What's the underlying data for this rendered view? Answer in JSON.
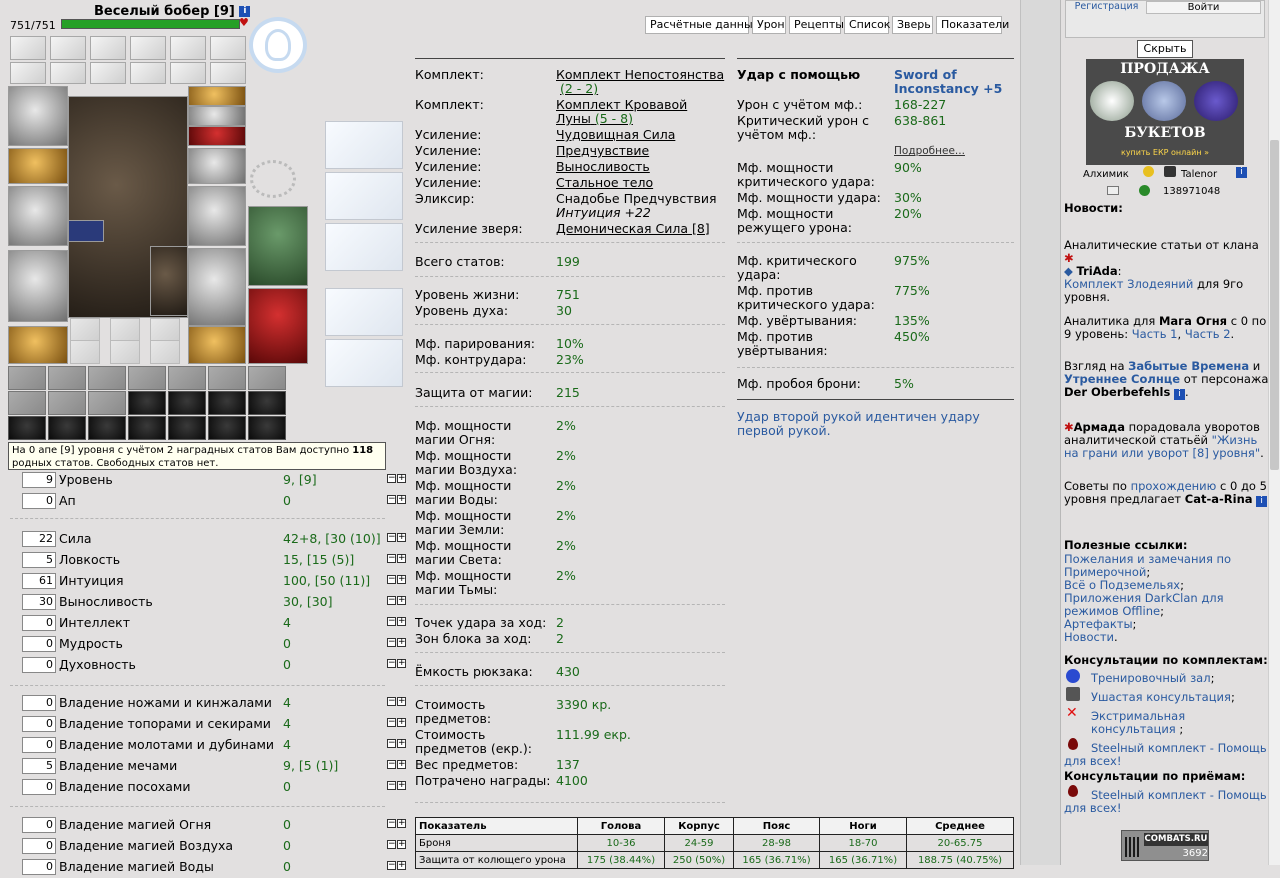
{
  "character": {
    "name": "Веселый бобер",
    "level": "[9]",
    "hp": "751/751"
  },
  "tabs": [
    "Расчётные данные",
    "Урон",
    "Рецепты",
    "Список",
    "Зверь",
    "Показатели"
  ],
  "level_tooltip": {
    "pre": "На 0 апе [9] уровня с учётом 2 наградных статов Вам доступно ",
    "num": "118",
    "post": " родных статов. Свободных статов нет."
  },
  "stats": [
    {
      "input": "9",
      "label": "Уровень",
      "value": "9, [9]"
    },
    {
      "input": "0",
      "label": "Ап",
      "value": "0"
    },
    {
      "input": "22",
      "label": "Сила",
      "value": "42+8, [30 (10)]"
    },
    {
      "input": "5",
      "label": "Ловкость",
      "value": "15, [15 (5)]"
    },
    {
      "input": "61",
      "label": "Интуиция",
      "value": "100, [50 (11)]"
    },
    {
      "input": "30",
      "label": "Выносливость",
      "value": "30, [30]"
    },
    {
      "input": "0",
      "label": "Интеллект",
      "value": "4"
    },
    {
      "input": "0",
      "label": "Мудрость",
      "value": "0"
    },
    {
      "input": "0",
      "label": "Духовность",
      "value": "0"
    },
    {
      "input": "0",
      "label": "Владение ножами и кинжалами",
      "value": "4"
    },
    {
      "input": "0",
      "label": "Владение топорами и секирами",
      "value": "4"
    },
    {
      "input": "0",
      "label": "Владение молотами и дубинами",
      "value": "4"
    },
    {
      "input": "5",
      "label": "Владение мечами",
      "value": "9, [5 (1)]"
    },
    {
      "input": "0",
      "label": "Владение посохами",
      "value": "0"
    },
    {
      "input": "0",
      "label": "Владение магией Огня",
      "value": "0"
    },
    {
      "input": "0",
      "label": "Владение магией Воздуха",
      "value": "0"
    },
    {
      "input": "0",
      "label": "Владение магией Воды",
      "value": "0"
    }
  ],
  "center": {
    "sets": [
      {
        "label": "Комплект:",
        "value": "Комплект Непостоянства",
        "extra": "(2 - 2)"
      },
      {
        "label": "Комплект:",
        "value": "Комплект Кровавой Луны",
        "extra": "(5 - 8)"
      }
    ],
    "boosts": [
      {
        "label": "Усиление:",
        "value": "Чудовищная Сила"
      },
      {
        "label": "Усиление:",
        "value": "Предчувствие"
      },
      {
        "label": "Усиление:",
        "value": "Выносливость"
      },
      {
        "label": "Усиление:",
        "value": "Стальное тело"
      }
    ],
    "elixir": {
      "label": "Эликсир:",
      "value": "Снадобье Предчувствия",
      "detail": "Интуиция +22"
    },
    "pet_boost": {
      "label": "Усиление зверя:",
      "value": "Демоническая Сила [8]"
    },
    "total_stats": {
      "label": "Всего статов:",
      "value": "199"
    },
    "hp_level": {
      "label": "Уровень жизни:",
      "value": "751"
    },
    "spirit_level": {
      "label": "Уровень духа:",
      "value": "30"
    },
    "parry": {
      "label": "Мф. парирования:",
      "value": "10%"
    },
    "counter": {
      "label": "Мф. контрудара:",
      "value": "23%"
    },
    "magic_def": {
      "label": "Защита от магии:",
      "value": "215"
    },
    "magic_power": [
      {
        "label": "Мф. мощности магии Огня:",
        "value": "2%"
      },
      {
        "label": "Мф. мощности магии Воздуха:",
        "value": "2%"
      },
      {
        "label": "Мф. мощности магии Воды:",
        "value": "2%"
      },
      {
        "label": "Мф. мощности магии Земли:",
        "value": "2%"
      },
      {
        "label": "Мф. мощности магии Света:",
        "value": "2%"
      },
      {
        "label": "Мф. мощности магии Тьмы:",
        "value": "2%"
      }
    ],
    "hit_points": {
      "label": "Точек удара за ход:",
      "value": "2"
    },
    "block_zones": {
      "label": "Зон блока за ход:",
      "value": "2"
    },
    "backpack": {
      "label": "Ёмкость рюкзака:",
      "value": "430"
    },
    "items_cost": {
      "label": "Стоимость предметов:",
      "value": "3390 кр."
    },
    "items_cost_ekr": {
      "label": "Стоимость предметов (екр.):",
      "value": "111.99 екр."
    },
    "items_weight": {
      "label": "Вес предметов:",
      "value": "137"
    },
    "award_spent": {
      "label": "Потрачено награды:",
      "value": "4100"
    }
  },
  "attack": {
    "header": "Удар с помощью",
    "weapon": "Sword of Inconstancy +5",
    "damage": {
      "label": "Урон с учётом мф.:",
      "value": "168-227"
    },
    "crit_damage": {
      "label": "Критический урон с учётом мф.:",
      "value": "638-861"
    },
    "more": "Подробнее...",
    "crit_power": {
      "label": "Мф. мощности критического удара:",
      "value": "90%"
    },
    "hit_power": {
      "label": "Мф. мощности удара:",
      "value": "30%"
    },
    "cut_power": {
      "label": "Мф. мощности режущего урона:",
      "value": "20%"
    },
    "crit": {
      "label": "Мф. критического удара:",
      "value": "975%"
    },
    "anti_crit": {
      "label": "Мф. против критического удара:",
      "value": "775%"
    },
    "dodge": {
      "label": "Мф. увёртывания:",
      "value": "135%"
    },
    "anti_dodge": {
      "label": "Мф. против увёртывания:",
      "value": "450%"
    },
    "armor_break": {
      "label": "Мф. пробоя брони:",
      "value": "5%"
    },
    "note": "Удар второй рукой идентичен удару первой рукой."
  },
  "table": {
    "headers": [
      "Показатель",
      "Голова",
      "Корпус",
      "Пояс",
      "Ноги",
      "Среднее"
    ],
    "rows": [
      [
        "Броня",
        "10-36",
        "24-59",
        "28-98",
        "18-70",
        "20-65.75"
      ],
      [
        "Защита от колющего урона",
        "175 (38.44%)",
        "250 (50%)",
        "165 (36.71%)",
        "165 (36.71%)",
        "188.75 (40.75%)"
      ]
    ]
  },
  "right": {
    "register": "Регистрация",
    "login": "Войти",
    "hide": "Скрыть",
    "banner_top": "ПРОДАЖА",
    "banner_mid": "БУКЕТОВ",
    "banner_bottom": "купить ЕКР онлайн »",
    "alchemist": "Алхимик",
    "alchemist_name": "Talenor",
    "alchemist_icq": "138971048",
    "news_title": "Новости:",
    "news1_pre": "Аналитические статьи от клана",
    "news1_clan": "TriAda",
    "news1_link": "Комплект Злодеяний",
    "news1_post": "для 9го уровня.",
    "news2_pre": "Аналитика для",
    "news2_b": "Мага Огня",
    "news2_mid": "с 0 по 9 уровень:",
    "news2_l1": "Часть 1",
    "news2_l2": "Часть 2",
    "news3_pre": "Взгляд на",
    "news3_l1": "Забытые Времена",
    "news3_and": "и",
    "news3_l2": "Утреннее Солнце",
    "news3_mid": "от персонажа",
    "news3_b": "Der Oberbefehls",
    "news4_b": "Армада",
    "news4_mid": "порадовала уворотов аналитической статьёй",
    "news4_link": "\"Жизнь на грани или уворот [8] уровня\"",
    "news5_pre": "Советы по",
    "news5_link": "прохождению",
    "news5_mid": "с 0 до 5 уровня предлагает",
    "news5_b": "Cat-a-Rina",
    "useful_title": "Полезные ссылки:",
    "useful": [
      "Пожелания и замечания по Примерочной",
      "Всё о Подземельях",
      "Приложения DarkClan для режимов Offline",
      "Артефакты",
      "Новости"
    ],
    "consult_sets_title": "Консультации по комплектам:",
    "consult_sets": [
      "Тренировочный зал",
      "Ушастая консультация",
      "Экстримальная консультация",
      "Steelный комплект - Помощь для всех!"
    ],
    "consult_tricks_title": "Консультации по приёмам:",
    "consult_tricks": [
      "Steelный комплект - Помощь для всех!"
    ],
    "counter_label": "COMBATS.RU",
    "counter_value": "3692"
  }
}
